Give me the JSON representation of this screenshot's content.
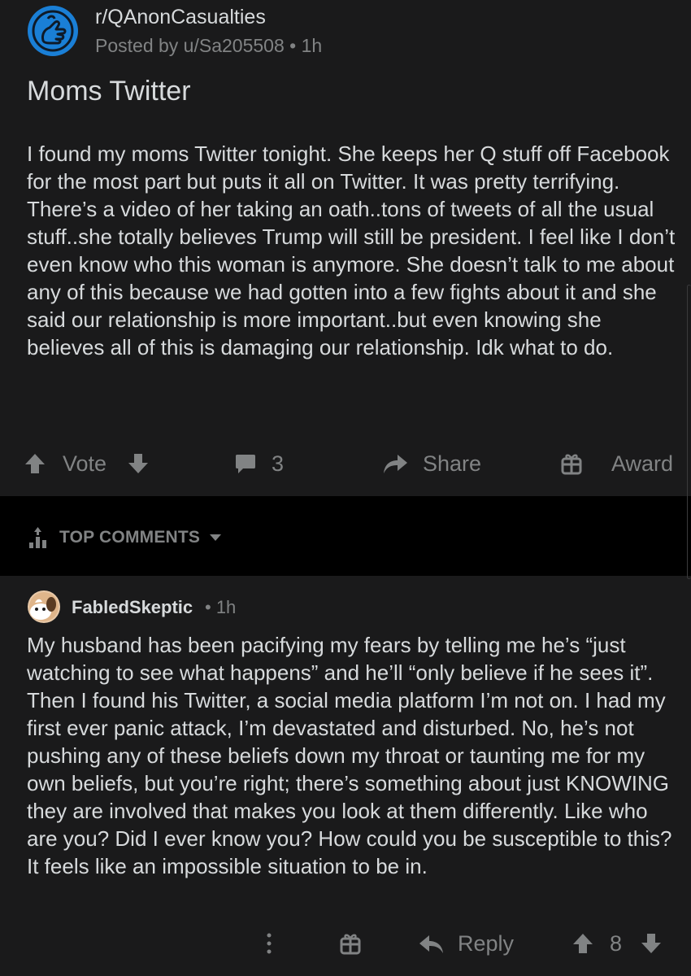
{
  "post": {
    "subreddit": "r/QAnonCasualties",
    "posted_by": "Posted by u/Sa205508 • 1h",
    "title": "Moms Twitter",
    "body": "I found my moms Twitter tonight.  She keeps her Q stuff off Facebook for the most part but puts it all on Twitter. It was pretty terrifying. There’s a video of her taking an oath..tons of tweets of all the usual stuff..she totally believes Trump will still be president. I feel like I don’t even know who this woman is anymore. She doesn’t talk to me about any of this because we had gotten into a few fights about it and she said our relationship is more important..but even knowing she believes all of this is damaging our relationship. Idk what to do.",
    "actions": {
      "vote_label": "Vote",
      "comment_count": "3",
      "share_label": "Share",
      "award_label": "Award"
    }
  },
  "comments_header": {
    "sort_label": "TOP COMMENTS"
  },
  "comment": {
    "author": "FabledSkeptic",
    "meta": "• 1h",
    "body": "My husband has been pacifying my fears by telling me he’s “just watching to see what happens” and he’ll “only believe if he sees it”. Then I found his Twitter, a social media platform I’m not on. I had my first ever panic attack, I’m devastated and disturbed. No, he’s not pushing any of these beliefs down my throat or taunting me for my own beliefs, but you’re right; there’s something about just KNOWING they are involved that makes you look at them differently. Like who are you? Did I ever know you? How could you be susceptible to this? It feels like an impossible situation to be in.",
    "actions": {
      "reply_label": "Reply",
      "score": "8"
    }
  },
  "icons": {
    "subreddit_avatar": "subreddit-avatar-icon",
    "upvote": "upvote-arrow-icon",
    "downvote": "downvote-arrow-icon",
    "comment": "comment-bubble-icon",
    "share": "share-arrow-icon",
    "award": "gift-icon",
    "sort": "sort-bars-icon",
    "caret": "caret-down-icon",
    "more": "more-vertical-icon",
    "reply": "reply-arrow-icon",
    "user_avatar": "user-avatar-icon"
  },
  "colors": {
    "background": "#1a1a1b",
    "band": "#000000",
    "text": "#d7dadc",
    "muted": "#818384",
    "subreddit_icon": "#1a7fd6"
  }
}
